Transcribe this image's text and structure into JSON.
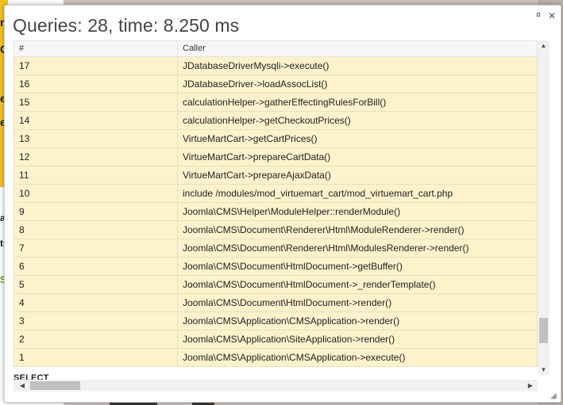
{
  "backdrop": {
    "glyphs": [
      "n",
      "C",
      "e",
      "e",
      "ar",
      "tr",
      "S"
    ]
  },
  "modal": {
    "title": "Queries: 28, time: 8.250 ms",
    "maximize_icon": "¤",
    "close_icon": "✕"
  },
  "table": {
    "headers": [
      "#",
      "Caller"
    ],
    "rows": [
      {
        "num": "17",
        "caller": "JDatabaseDriverMysqli->execute()"
      },
      {
        "num": "16",
        "caller": "JDatabaseDriver->loadAssocList()"
      },
      {
        "num": "15",
        "caller": "calculationHelper->gatherEffectingRulesForBill()"
      },
      {
        "num": "14",
        "caller": "calculationHelper->getCheckoutPrices()"
      },
      {
        "num": "13",
        "caller": "VirtueMartCart->getCartPrices()"
      },
      {
        "num": "12",
        "caller": "VirtueMartCart->prepareCartData()"
      },
      {
        "num": "11",
        "caller": "VirtueMartCart->prepareAjaxData()"
      },
      {
        "num": "10",
        "caller": "include /modules/mod_virtuemart_cart/mod_virtuemart_cart.php"
      },
      {
        "num": "9",
        "caller": "Joomla\\CMS\\Helper\\ModuleHelper::renderModule()"
      },
      {
        "num": "8",
        "caller": "Joomla\\CMS\\Document\\Renderer\\Html\\ModuleRenderer->render()"
      },
      {
        "num": "7",
        "caller": "Joomla\\CMS\\Document\\Renderer\\Html\\ModulesRenderer->render()"
      },
      {
        "num": "6",
        "caller": "Joomla\\CMS\\Document\\HtmlDocument->getBuffer()"
      },
      {
        "num": "5",
        "caller": "Joomla\\CMS\\Document\\HtmlDocument->_renderTemplate()"
      },
      {
        "num": "4",
        "caller": "Joomla\\CMS\\Document\\HtmlDocument->render()"
      },
      {
        "num": "3",
        "caller": "Joomla\\CMS\\Application\\CMSApplication->render()"
      },
      {
        "num": "2",
        "caller": "Joomla\\CMS\\Application\\SiteApplication->render()"
      },
      {
        "num": "1",
        "caller": "Joomla\\CMS\\Application\\CMSApplication->execute()"
      }
    ],
    "next_label": "SELECT"
  },
  "scrollbars": {
    "up": "▲",
    "down": "▼",
    "left": "◀",
    "right": "▶",
    "grip": "◢"
  },
  "colors": {
    "row_bg": "#fdf2cc",
    "backdrop_accent": "#f4c31a"
  }
}
